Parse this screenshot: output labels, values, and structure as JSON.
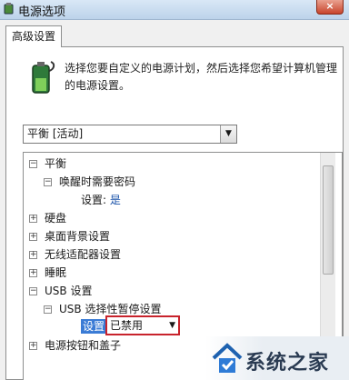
{
  "window": {
    "title": "电源选项",
    "close_label": "×"
  },
  "tab": {
    "label": "高级设置"
  },
  "description": "选择您要自定义的电源计划，然后选择您希望计算机管理的电源设置。",
  "plan_select": {
    "value": "平衡 [活动]"
  },
  "tree": {
    "balance": {
      "toggle": "−",
      "label": "平衡"
    },
    "wake_password": {
      "toggle": "−",
      "label": "唤醒时需要密码"
    },
    "wake_setting": {
      "label": "设置:",
      "value": "是"
    },
    "hard_disk": {
      "toggle": "+",
      "label": "硬盘"
    },
    "desktop_bg": {
      "toggle": "+",
      "label": "桌面背景设置"
    },
    "wireless": {
      "toggle": "+",
      "label": "无线适配器设置"
    },
    "sleep": {
      "toggle": "+",
      "label": "睡眠"
    },
    "usb": {
      "toggle": "−",
      "label": "USB 设置"
    },
    "usb_suspend": {
      "toggle": "−",
      "label": "USB 选择性暂停设置"
    },
    "usb_setting": {
      "label": "设置:",
      "value": "已禁用"
    },
    "power_buttons": {
      "toggle": "+",
      "label": "电源按钮和盖子"
    }
  },
  "watermark": {
    "text": "系统之家"
  },
  "colors": {
    "highlight": "#3a7bd5",
    "red_outline": "#c8232c",
    "link_blue": "#1750a8"
  }
}
